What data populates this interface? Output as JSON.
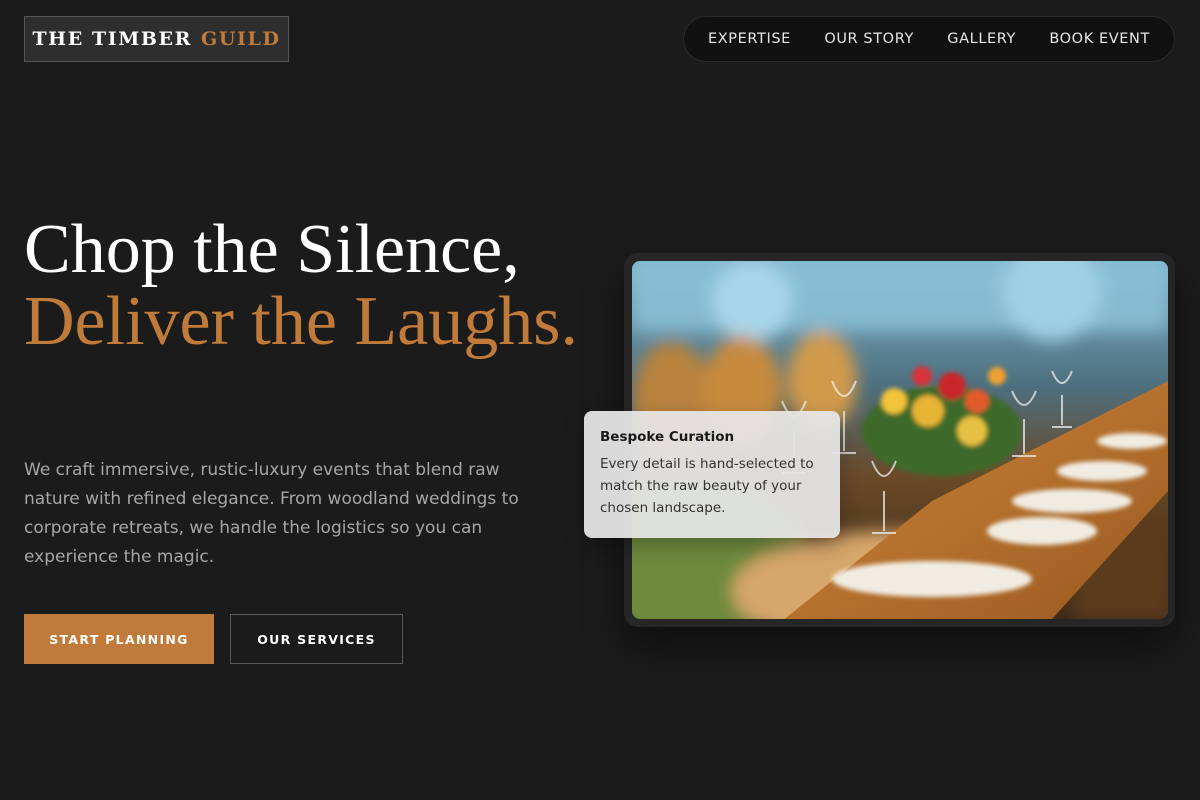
{
  "brand": {
    "word1": "THE TIMBER",
    "word2": "GUILD"
  },
  "nav": {
    "items": [
      {
        "label": "EXPERTISE"
      },
      {
        "label": "OUR STORY"
      },
      {
        "label": "GALLERY"
      },
      {
        "label": "BOOK EVENT"
      }
    ]
  },
  "hero": {
    "line1": "Chop the Silence,",
    "line2": "Deliver the Laughs.",
    "description": "We craft immersive, rustic-luxury events that blend raw nature with refined elegance. From woodland weddings to corporate retreats, we handle the logistics so you can experience the magic.",
    "primary_cta": "START PLANNING",
    "secondary_cta": "OUR SERVICES"
  },
  "feature_card": {
    "title": "Bespoke Curation",
    "body": "Every detail is hand-selected to match the raw beauty of your chosen landscape."
  },
  "colors": {
    "background": "#1b1b1b",
    "accent": "#c07a3a",
    "text_primary": "#ffffff",
    "text_muted": "#a6a6a6"
  },
  "image": {
    "subject": "banquet-table-with-flowers-photo"
  }
}
